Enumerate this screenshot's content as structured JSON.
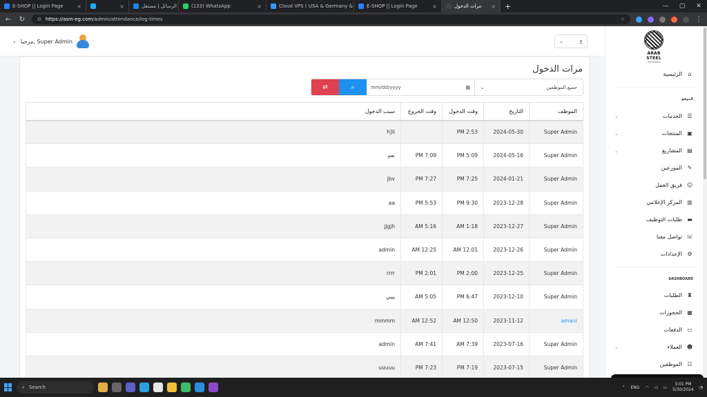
{
  "browser": {
    "tabs": [
      {
        "label": "E-SHOP || Login Page",
        "fav": "#2a7fff"
      },
      {
        "label": "",
        "fav": "#22aaff"
      },
      {
        "label": "الرسائل | مستقل",
        "fav": "#1e88e5"
      },
      {
        "label": "(133) WhatsApp",
        "fav": "#25d366"
      },
      {
        "label": "Cloud VPS ( USA & Germany & I",
        "fav": "#3399ff"
      },
      {
        "label": "E-SHOP || Login Page",
        "fav": "#2a7fff"
      },
      {
        "label": "مرات الدخول",
        "fav": "#444"
      }
    ],
    "url_host": "https://asm-eg.com",
    "url_path": "/admin/attendance/log-times"
  },
  "header": {
    "user_greeting": "مرحبا, Super Admin",
    "language_value": "ع"
  },
  "sidebar": {
    "logo_line1": "ARAB STEEL",
    "logo_line2": "FOR MINING",
    "home": "الرئيسية",
    "section_site": "الموقع",
    "site_items": [
      {
        "label": "الخدمات",
        "icon": "list-icon",
        "chev": true
      },
      {
        "label": "المنتجات",
        "icon": "box-icon",
        "chev": true
      },
      {
        "label": "المشاريع",
        "icon": "projects-icon",
        "chev": true
      },
      {
        "label": "الموزعين",
        "icon": "feather-icon",
        "chev": false
      },
      {
        "label": "فريق العمل",
        "icon": "team-icon",
        "chev": false
      },
      {
        "label": "المركز الإعلامي",
        "icon": "media-icon",
        "chev": false
      },
      {
        "label": "طلبات التوظيف",
        "icon": "jobs-icon",
        "chev": false
      },
      {
        "label": "تواصل معنا",
        "icon": "phone-icon",
        "chev": false
      },
      {
        "label": "الإعدادات",
        "icon": "settings-icon",
        "chev": false
      }
    ],
    "section_dashboard": "DASHBOARD",
    "dash_items": [
      {
        "label": "الطلبات",
        "icon": "orders-icon",
        "chev": false
      },
      {
        "label": "الحجوزات",
        "icon": "bookings-icon",
        "chev": false
      },
      {
        "label": "الدفعات",
        "icon": "payments-icon",
        "chev": false
      },
      {
        "label": "العملاء",
        "icon": "clients-icon",
        "chev": true
      },
      {
        "label": "الموظفين",
        "icon": "employees-icon",
        "chev": false
      }
    ]
  },
  "main": {
    "title": "مرات الدخول",
    "employee_select": "جميع الموظفين",
    "date_placeholder": "mm/dd/yyyy",
    "columns": [
      "الموظف",
      "التاريخ",
      "وقت الدخول",
      "وقت الخروج",
      "سبب الدخول"
    ],
    "rows": [
      [
        "Super Admin",
        "2024-05-30",
        "2:53 PM",
        "",
        "h]li"
      ],
      [
        "Super Admin",
        "2024-05-16",
        "5:09 PM",
        "7:09 PM",
        "نعم"
      ],
      [
        "Super Admin",
        "2024-01-21",
        "7:25 PM",
        "7:27 PM",
        "jbv"
      ],
      [
        "Super Admin",
        "2023-12-28",
        "9:30 PM",
        "5:53 PM",
        "aa"
      ],
      [
        "Super Admin",
        "2023-12-27",
        "1:18 AM",
        "5:16 AM",
        "jjgjh"
      ],
      [
        "Super Admin",
        "2023-12-26",
        "12:01 AM",
        "12:25 AM",
        "admin"
      ],
      [
        "Super Admin",
        "2023-12-25",
        "2:00 PM",
        "2:01 PM",
        "rrrr"
      ],
      [
        "Super Admin",
        "2023-12-10",
        "6:47 PM",
        "5:05 AM",
        "يييي"
      ],
      [
        "amani",
        "2023-11-12",
        "12:50 AM",
        "12:52 AM",
        "mmmm"
      ],
      [
        "Super Admin",
        "2023-07-16",
        "7:39 AM",
        "7:41 AM",
        "admin"
      ],
      [
        "Super Admin",
        "2023-07-15",
        "7:19 PM",
        "7:23 PM",
        "uuuuu"
      ]
    ]
  },
  "taskbar": {
    "search": "Search",
    "lang": "ENG",
    "time": "3:01 PM",
    "date": "5/30/2024"
  }
}
